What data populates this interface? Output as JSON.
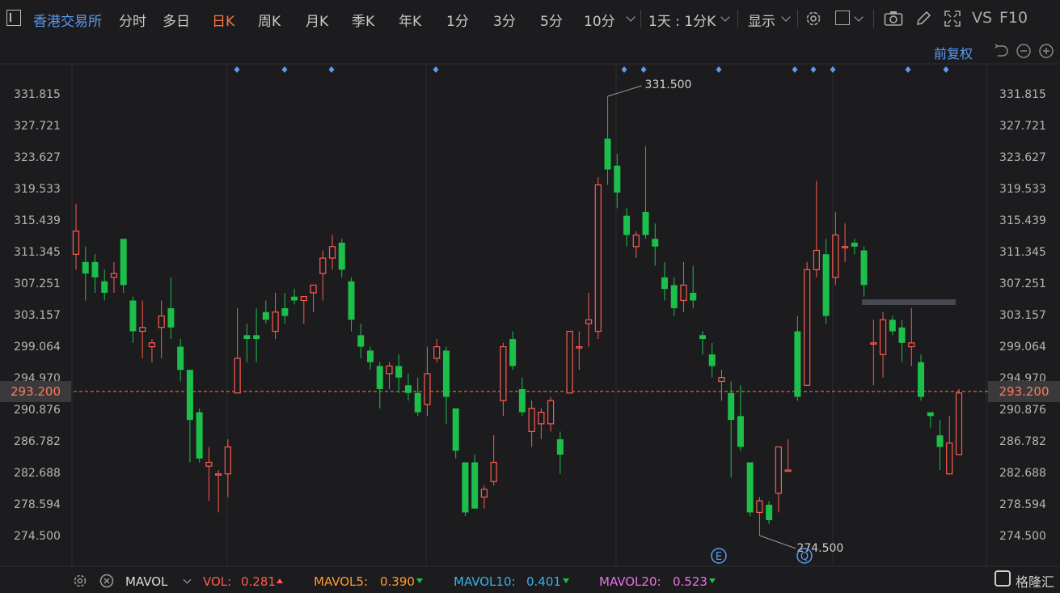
{
  "toolbar": {
    "exchange": "香港交易所",
    "periods": [
      "分时",
      "多日",
      "日K",
      "周K",
      "月K",
      "季K",
      "年K",
      "1分",
      "3分",
      "5分",
      "10分"
    ],
    "active_period": "日K",
    "interval_select": "1天 : 1分K",
    "display_label": "显示",
    "vs_label": "VS",
    "f10_label": "F10"
  },
  "adjust_label": "前复权",
  "colors": {
    "up": "#ff5a4e",
    "down": "#1bbf4a",
    "accent": "#5b9bf0",
    "current": "#ff7a5a"
  },
  "current_price": "293.200",
  "chart_data": {
    "type": "candlestick",
    "title": "",
    "y_ticks": [
      "331.815",
      "327.721",
      "323.627",
      "319.533",
      "315.439",
      "311.345",
      "307.251",
      "303.157",
      "299.064",
      "294.970",
      "290.876",
      "286.782",
      "282.688",
      "278.594",
      "274.500"
    ],
    "ylim": [
      272.0,
      335.0
    ],
    "current": 293.2,
    "max_label": "331.500",
    "min_label": "274.500",
    "event_markers": [
      "E",
      "Q"
    ],
    "candles": [
      {
        "o": 311,
        "h": 317.5,
        "l": 309,
        "c": 314
      },
      {
        "o": 310,
        "h": 312,
        "l": 305,
        "c": 308.5
      },
      {
        "o": 310,
        "h": 311,
        "l": 306,
        "c": 308
      },
      {
        "o": 307.5,
        "h": 309,
        "l": 305,
        "c": 306
      },
      {
        "o": 308,
        "h": 310,
        "l": 306,
        "c": 308.5
      },
      {
        "o": 313,
        "h": 313,
        "l": 306,
        "c": 307
      },
      {
        "o": 305,
        "h": 305.5,
        "l": 299.5,
        "c": 301
      },
      {
        "o": 301,
        "h": 305,
        "l": 297.5,
        "c": 301.5
      },
      {
        "o": 299,
        "h": 300,
        "l": 297,
        "c": 299.5
      },
      {
        "o": 301.5,
        "h": 305,
        "l": 297.5,
        "c": 303
      },
      {
        "o": 304,
        "h": 308,
        "l": 300,
        "c": 301.5
      },
      {
        "o": 299,
        "h": 300,
        "l": 294.5,
        "c": 296
      },
      {
        "o": 296,
        "h": 296,
        "l": 284,
        "c": 289.5
      },
      {
        "o": 290.5,
        "h": 291,
        "l": 284,
        "c": 284.5
      },
      {
        "o": 283.5,
        "h": 286,
        "l": 279,
        "c": 284
      },
      {
        "o": 282.5,
        "h": 283,
        "l": 277.5,
        "c": 282.5
      },
      {
        "o": 282.5,
        "h": 287,
        "l": 279.5,
        "c": 286
      },
      {
        "o": 293,
        "h": 304,
        "l": 293,
        "c": 297.5
      },
      {
        "o": 300.5,
        "h": 302,
        "l": 297,
        "c": 300
      },
      {
        "o": 300.5,
        "h": 304,
        "l": 297,
        "c": 300
      },
      {
        "o": 303.5,
        "h": 305,
        "l": 302,
        "c": 302.5
      },
      {
        "o": 301,
        "h": 306,
        "l": 300,
        "c": 303.5
      },
      {
        "o": 304,
        "h": 306,
        "l": 302,
        "c": 303
      },
      {
        "o": 305.5,
        "h": 306.5,
        "l": 304.5,
        "c": 305
      },
      {
        "o": 305,
        "h": 305.5,
        "l": 302,
        "c": 305.5
      },
      {
        "o": 306,
        "h": 307,
        "l": 303.5,
        "c": 307
      },
      {
        "o": 308.5,
        "h": 311.5,
        "l": 305,
        "c": 310.5
      },
      {
        "o": 310.5,
        "h": 313.5,
        "l": 309,
        "c": 312
      },
      {
        "o": 312.5,
        "h": 313,
        "l": 308,
        "c": 309
      },
      {
        "o": 307.5,
        "h": 308,
        "l": 301,
        "c": 302.5
      },
      {
        "o": 300.5,
        "h": 302,
        "l": 297.5,
        "c": 299
      },
      {
        "o": 298.5,
        "h": 299,
        "l": 296,
        "c": 297
      },
      {
        "o": 296.5,
        "h": 297,
        "l": 291,
        "c": 293.5
      },
      {
        "o": 295.5,
        "h": 297,
        "l": 293.5,
        "c": 296.5
      },
      {
        "o": 296.5,
        "h": 298,
        "l": 293,
        "c": 295
      },
      {
        "o": 294,
        "h": 295.5,
        "l": 292,
        "c": 293
      },
      {
        "o": 293,
        "h": 295,
        "l": 290,
        "c": 290.5
      },
      {
        "o": 291.5,
        "h": 299,
        "l": 290,
        "c": 295.5
      },
      {
        "o": 297.5,
        "h": 300,
        "l": 297,
        "c": 299
      },
      {
        "o": 298.5,
        "h": 299,
        "l": 289,
        "c": 292.5
      },
      {
        "o": 291,
        "h": 291,
        "l": 284.5,
        "c": 285.5
      },
      {
        "o": 284,
        "h": 284,
        "l": 277,
        "c": 277.5
      },
      {
        "o": 284,
        "h": 285,
        "l": 278,
        "c": 278
      },
      {
        "o": 279.5,
        "h": 281,
        "l": 278,
        "c": 280.5
      },
      {
        "o": 281.5,
        "h": 287.5,
        "l": 281,
        "c": 284
      },
      {
        "o": 292,
        "h": 299.5,
        "l": 290,
        "c": 299
      },
      {
        "o": 300,
        "h": 301,
        "l": 296,
        "c": 296.5
      },
      {
        "o": 293.5,
        "h": 295,
        "l": 290,
        "c": 290.5
      },
      {
        "o": 288,
        "h": 292,
        "l": 286,
        "c": 291
      },
      {
        "o": 289,
        "h": 291,
        "l": 287,
        "c": 290.5
      },
      {
        "o": 289,
        "h": 292.5,
        "l": 288,
        "c": 292
      },
      {
        "o": 287,
        "h": 288,
        "l": 282.5,
        "c": 285
      },
      {
        "o": 293,
        "h": 301,
        "l": 293,
        "c": 301
      },
      {
        "o": 299,
        "h": 301,
        "l": 296,
        "c": 299
      },
      {
        "o": 302,
        "h": 306,
        "l": 299,
        "c": 302.5
      },
      {
        "o": 301,
        "h": 321,
        "l": 300,
        "c": 320
      },
      {
        "o": 326,
        "h": 331.5,
        "l": 320,
        "c": 322
      },
      {
        "o": 322.5,
        "h": 324,
        "l": 317,
        "c": 319
      },
      {
        "o": 316,
        "h": 317,
        "l": 312,
        "c": 313.5
      },
      {
        "o": 312,
        "h": 314,
        "l": 310.5,
        "c": 313.5
      },
      {
        "o": 316.5,
        "h": 325,
        "l": 313,
        "c": 313.5
      },
      {
        "o": 313,
        "h": 315,
        "l": 309.5,
        "c": 312
      },
      {
        "o": 308,
        "h": 310,
        "l": 305,
        "c": 306.5
      },
      {
        "o": 307,
        "h": 308,
        "l": 303,
        "c": 304
      },
      {
        "o": 305,
        "h": 310,
        "l": 303.5,
        "c": 307
      },
      {
        "o": 306,
        "h": 309.5,
        "l": 304,
        "c": 305
      },
      {
        "o": 300.5,
        "h": 301,
        "l": 298,
        "c": 300
      },
      {
        "o": 298,
        "h": 299.5,
        "l": 295,
        "c": 296.5
      },
      {
        "o": 294.5,
        "h": 296,
        "l": 292,
        "c": 295
      },
      {
        "o": 293,
        "h": 294.5,
        "l": 282,
        "c": 289.5
      },
      {
        "o": 290,
        "h": 294,
        "l": 285.5,
        "c": 286
      },
      {
        "o": 284,
        "h": 284,
        "l": 277,
        "c": 277.5
      },
      {
        "o": 277.5,
        "h": 279.5,
        "l": 274.5,
        "c": 279
      },
      {
        "o": 278.5,
        "h": 279,
        "l": 276,
        "c": 276.5
      },
      {
        "o": 280,
        "h": 286,
        "l": 277.5,
        "c": 286
      },
      {
        "o": 283,
        "h": 287,
        "l": 283,
        "c": 283
      },
      {
        "o": 301,
        "h": 303,
        "l": 292,
        "c": 292.5
      },
      {
        "o": 294,
        "h": 310,
        "l": 294,
        "c": 309
      },
      {
        "o": 309,
        "h": 320.5,
        "l": 308,
        "c": 311.5
      },
      {
        "o": 311,
        "h": 313,
        "l": 302,
        "c": 303
      },
      {
        "o": 308,
        "h": 316.5,
        "l": 307,
        "c": 313.5
      },
      {
        "o": 312,
        "h": 315,
        "l": 310,
        "c": 312
      },
      {
        "o": 312.5,
        "h": 313,
        "l": 311,
        "c": 312
      },
      {
        "o": 311.5,
        "h": 312,
        "l": 305.5,
        "c": 307
      },
      {
        "o": 299.5,
        "h": 302.5,
        "l": 294,
        "c": 299.5
      },
      {
        "o": 298,
        "h": 303.5,
        "l": 295,
        "c": 302.5
      },
      {
        "o": 302.5,
        "h": 303,
        "l": 300.5,
        "c": 301
      },
      {
        "o": 301.5,
        "h": 302.5,
        "l": 297,
        "c": 299.5
      },
      {
        "o": 299,
        "h": 304,
        "l": 296.5,
        "c": 299.5
      },
      {
        "o": 297,
        "h": 298,
        "l": 292,
        "c": 292.5
      },
      {
        "o": 290.5,
        "h": 290.5,
        "l": 288.5,
        "c": 290
      },
      {
        "o": 287.5,
        "h": 289.5,
        "l": 283,
        "c": 286
      },
      {
        "o": 282.5,
        "h": 290,
        "l": 282.5,
        "c": 286.5
      },
      {
        "o": 285,
        "h": 293.5,
        "l": 285,
        "c": 293
      }
    ]
  },
  "volume_bar": {
    "indicator": "MAVOL",
    "vol_label": "VOL:",
    "vol_value": "0.281",
    "mavol5_label": "MAVOL5:",
    "mavol5_value": "0.390",
    "mavol10_label": "MAVOL10:",
    "mavol10_value": "0.401",
    "mavol20_label": "MAVOL20:",
    "mavol20_value": "0.523",
    "mavol5_color": "#ff9a2e",
    "mavol10_color": "#3ab0e8",
    "mavol20_color": "#e870e8"
  },
  "brand": "格隆汇"
}
